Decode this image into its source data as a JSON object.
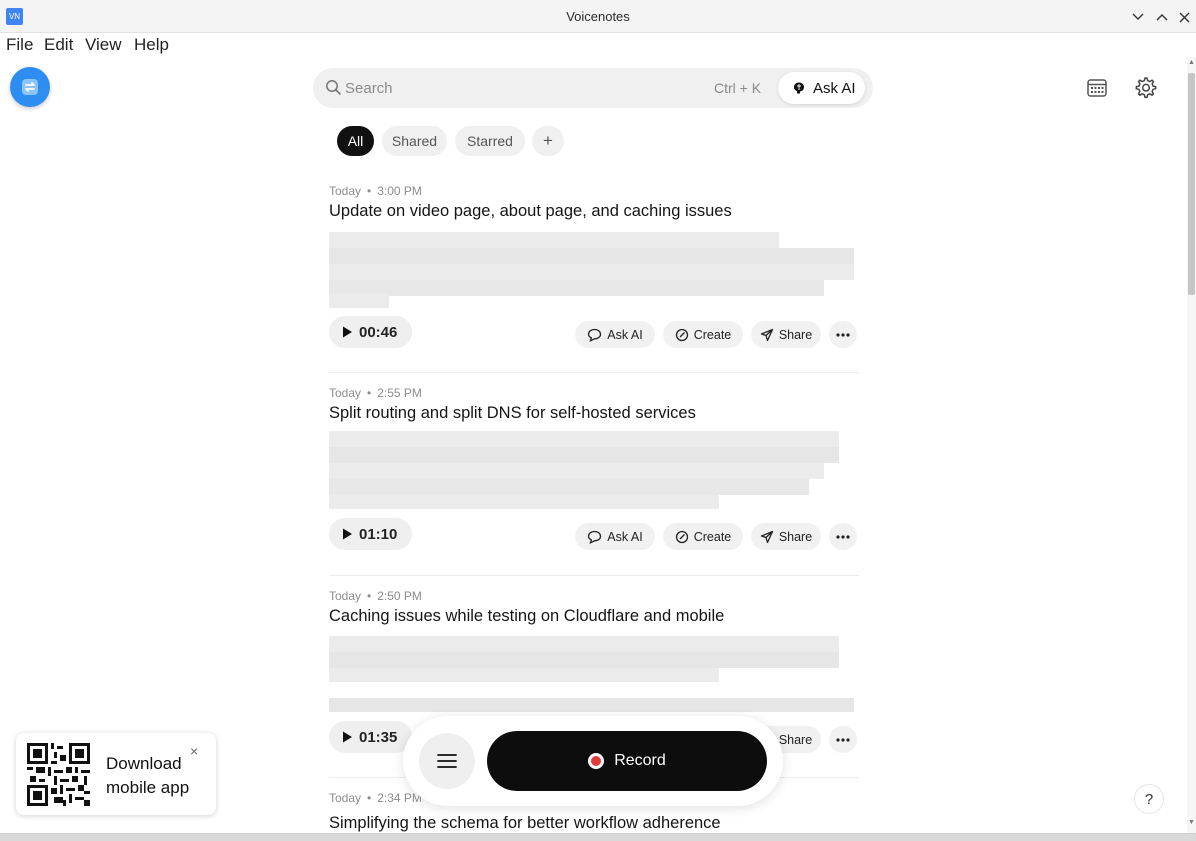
{
  "window": {
    "title": "Voicenotes",
    "app_icon_text": "VN"
  },
  "menu": [
    "File",
    "Edit",
    "View",
    "Help"
  ],
  "search": {
    "placeholder": "Search",
    "shortcut": "Ctrl + K",
    "ask_ai_label": "Ask AI"
  },
  "filters": [
    {
      "label": "All",
      "active": true
    },
    {
      "label": "Shared",
      "active": false
    },
    {
      "label": "Starred",
      "active": false
    },
    {
      "label": "+",
      "active": false
    }
  ],
  "notes": [
    {
      "day": "Today",
      "time": "3:00 PM",
      "title": "Update on video page, about page, and caching issues",
      "duration": "00:46"
    },
    {
      "day": "Today",
      "time": "2:55 PM",
      "title": "Split routing and split DNS for self-hosted services",
      "duration": "01:10"
    },
    {
      "day": "Today",
      "time": "2:50 PM",
      "title": "Caching issues while testing on Cloudflare and mobile",
      "duration": "01:35"
    },
    {
      "day": "Today",
      "time": "2:34 PM",
      "title": "Simplifying the schema for better workflow adherence",
      "duration": ""
    }
  ],
  "note_actions": {
    "ask_ai": "Ask AI",
    "create": "Create",
    "share": "Share"
  },
  "qr_card": {
    "line1": "Download",
    "line2": "mobile app",
    "close": "×"
  },
  "record": {
    "label": "Record"
  },
  "help": {
    "label": "?"
  },
  "colors": {
    "accent": "#2e8df0",
    "record_dot": "#e23b3b",
    "record_bg": "#0d0d0d"
  }
}
